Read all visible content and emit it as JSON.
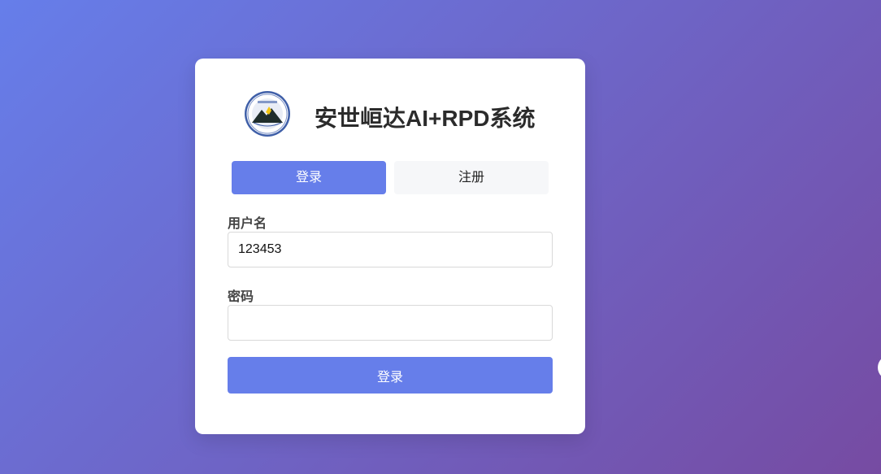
{
  "app": {
    "title": "安世峘达AI+RPD系统"
  },
  "tabs": {
    "login_label": "登录",
    "register_label": "注册",
    "active": "login"
  },
  "form": {
    "username_label": "用户名",
    "username_value": "123453",
    "password_label": "密码",
    "password_value": "",
    "submit_label": "登录"
  },
  "colors": {
    "primary": "#667eea",
    "background_start": "#667eea",
    "background_end": "#764ba2",
    "title_text": "#2b2b2b"
  },
  "icons": {
    "logo": "mountain-seal-logo"
  }
}
